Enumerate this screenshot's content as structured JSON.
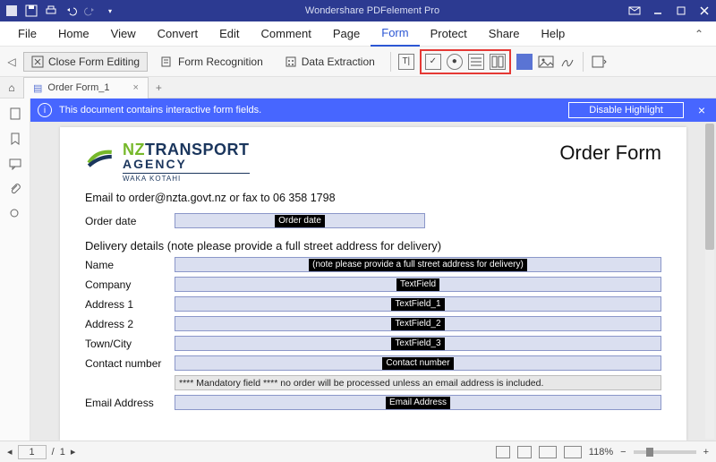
{
  "app": {
    "title": "Wondershare PDFelement Pro"
  },
  "menu": {
    "file": "File",
    "home": "Home",
    "view": "View",
    "convert": "Convert",
    "edit": "Edit",
    "comment": "Comment",
    "page": "Page",
    "form": "Form",
    "protect": "Protect",
    "share": "Share",
    "help": "Help"
  },
  "toolbar": {
    "close_form_editing": "Close Form Editing",
    "form_recognition": "Form Recognition",
    "data_extraction": "Data Extraction"
  },
  "tabs": {
    "doc1": "Order Form_1"
  },
  "infobar": {
    "message": "This document contains interactive form fields.",
    "disable_highlight": "Disable Highlight"
  },
  "doc": {
    "logo": {
      "nz": "NZ",
      "transport": "TRANSPORT",
      "agency": "AGENCY",
      "waka": "WAKA KOTAHI"
    },
    "title": "Order Form",
    "intro": "Email to order@nzta.govt.nz or fax to 06 358 1798",
    "labels": {
      "order_date": "Order date",
      "delivery_h": "Delivery details (note please provide a full street address for delivery)",
      "name": "Name",
      "company": "Company",
      "address1": "Address 1",
      "address2": "Address 2",
      "town": "Town/City",
      "contact": "Contact number",
      "email": "Email Address"
    },
    "field_tags": {
      "order_date": "Order date",
      "name": "(note please provide a full street address for delivery)",
      "company": "TextField",
      "address1": "TextField_1",
      "address2": "TextField_2",
      "town": "TextField_3",
      "contact": "Contact number",
      "email": "Email Address"
    },
    "mandatory_note": "**** Mandatory field **** no order will be processed unless an email address is included."
  },
  "status": {
    "page_current": "1",
    "page_sep": "/",
    "page_total": "1",
    "zoom": "118%"
  }
}
